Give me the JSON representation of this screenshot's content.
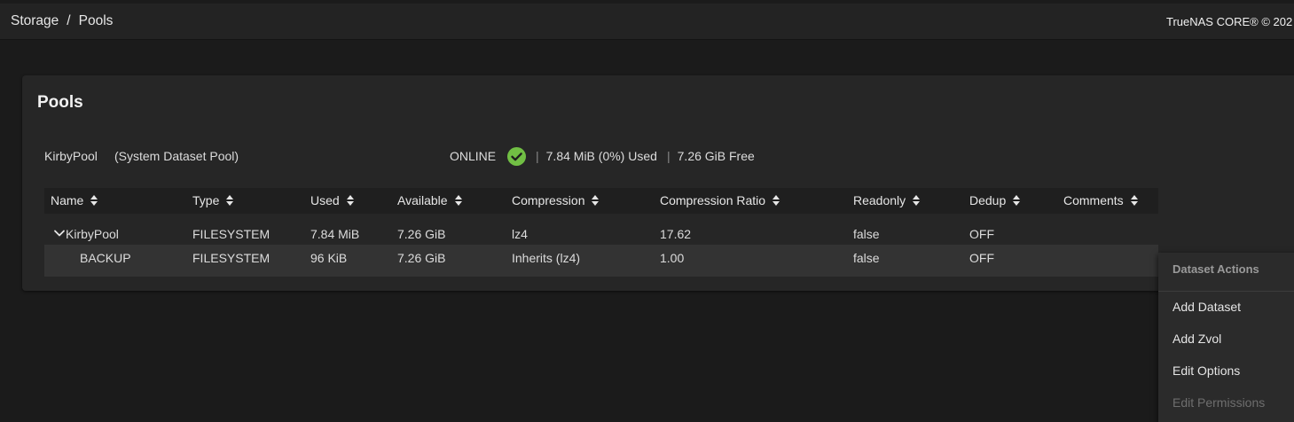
{
  "breadcrumb": {
    "items": [
      "Storage",
      "Pools"
    ],
    "separator": "/"
  },
  "brand": {
    "text": "TrueNAS CORE® © 202"
  },
  "card": {
    "title": "Pools"
  },
  "pool": {
    "name": "KirbyPool",
    "system_label": "(System Dataset Pool)",
    "status": "ONLINE",
    "status_color": "#71bf44",
    "used": "7.84 MiB (0%) Used",
    "free": "7.26 GiB Free",
    "separator": "|"
  },
  "table": {
    "columns": [
      "Name",
      "Type",
      "Used",
      "Available",
      "Compression",
      "Compression Ratio",
      "Readonly",
      "Dedup",
      "Comments"
    ],
    "rows": [
      {
        "name": "KirbyPool",
        "type": "FILESYSTEM",
        "used": "7.84 MiB",
        "available": "7.26 GiB",
        "compression": "lz4",
        "ratio": "17.62",
        "readonly": "false",
        "dedup": "OFF",
        "comments": ""
      },
      {
        "name": "BACKUP",
        "type": "FILESYSTEM",
        "used": "96 KiB",
        "available": "7.26 GiB",
        "compression": "Inherits (lz4)",
        "ratio": "1.00",
        "readonly": "false",
        "dedup": "OFF",
        "comments": ""
      }
    ]
  },
  "menu": {
    "title": "Dataset Actions",
    "items": [
      {
        "label": "Add Dataset",
        "disabled": false
      },
      {
        "label": "Add Zvol",
        "disabled": false
      },
      {
        "label": "Edit Options",
        "disabled": false
      },
      {
        "label": "Edit Permissions",
        "disabled": true
      }
    ]
  },
  "icons": {
    "status_ok": "check-circle-icon",
    "expand": "chevron-down-icon",
    "sort": "sort-icon"
  }
}
